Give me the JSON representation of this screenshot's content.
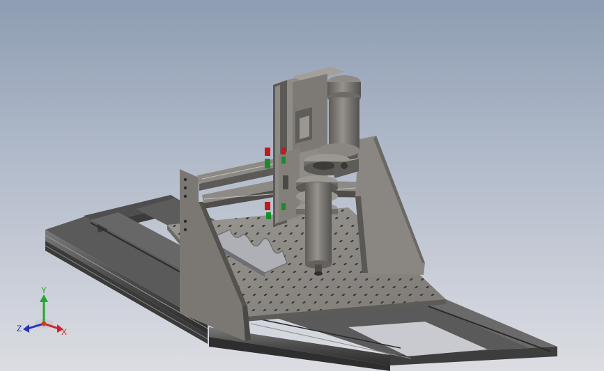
{
  "viewport": {
    "background_top": "#8e9db3",
    "background_bottom": "#dcdde3"
  },
  "model": {
    "frame_color": "#4d4d4d",
    "plate_color": "#8a8782",
    "plate_holes_color": "#2f2f2f",
    "gantry_color": "#7a7772",
    "spindle_color": "#7d7a75",
    "accent_red": "#c01a1a",
    "accent_green": "#1a8c2a"
  },
  "triad": {
    "x_label": "X",
    "y_label": "Y",
    "z_label": "Z",
    "x_color": "#d2202b",
    "y_color": "#1fa82e",
    "z_color": "#2632b8"
  }
}
